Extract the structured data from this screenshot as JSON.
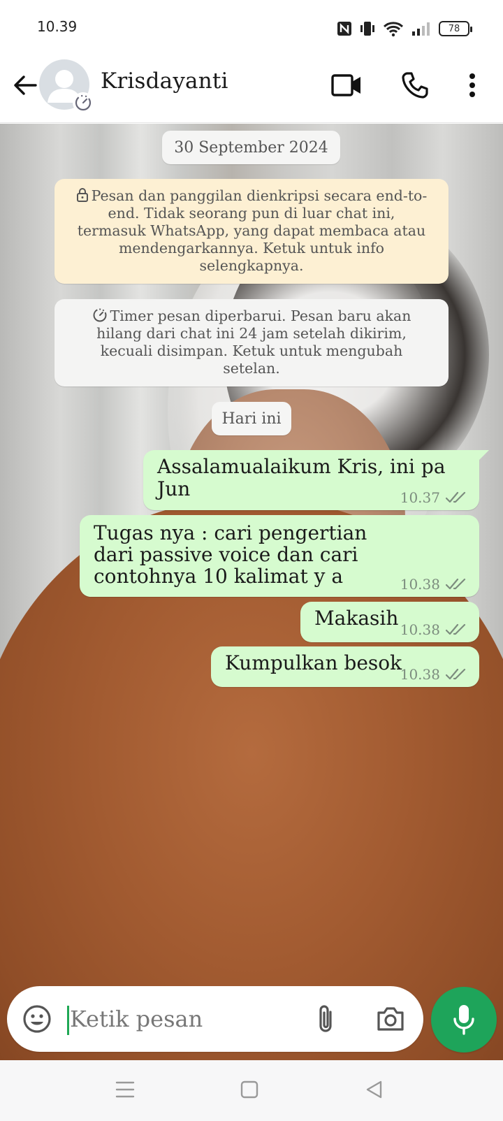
{
  "status_bar": {
    "time": "10.39",
    "battery_level": "78",
    "icons": [
      "nfc-icon",
      "vibrate-icon",
      "wifi-icon",
      "signal-icon",
      "battery-icon"
    ]
  },
  "header": {
    "contact_name": "Krisdayanti",
    "icons": {
      "back": "arrow-left-icon",
      "avatar": "default-avatar",
      "timer": "disappearing-timer-icon",
      "video": "video-camera-icon",
      "call": "phone-icon",
      "menu": "more-vert-icon"
    }
  },
  "chat": {
    "date_label": "30 September 2024",
    "encryption_notice": "Pesan dan panggilan dienkripsi secara end-to-end. Tidak seorang pun di luar chat ini, termasuk WhatsApp, yang dapat membaca atau mendengarkannya. Ketuk untuk info selengkapnya.",
    "timer_notice": "Timer pesan diperbarui. Pesan baru akan hilang dari chat ini 24 jam setelah dikirim, kecuali disimpan. Ketuk untuk mengubah setelan.",
    "today_label": "Hari ini",
    "messages": [
      {
        "text": "Assalamualaikum Kris, ini pa Jun",
        "time": "10.37",
        "status": "read"
      },
      {
        "text": "Tugas nya : cari pengertian dari passive voice dan cari contohnya 10 kalimat y a",
        "time": "10.38",
        "status": "read"
      },
      {
        "text": "Makasih",
        "time": "10.38",
        "status": "read"
      },
      {
        "text": "Kumpulkan besok",
        "time": "10.38",
        "status": "read"
      }
    ]
  },
  "input": {
    "placeholder": "Ketik pesan",
    "icons": {
      "emoji": "emoji-icon",
      "attach": "paperclip-icon",
      "camera": "camera-icon",
      "mic": "mic-icon"
    }
  },
  "colors": {
    "outgoing_bubble": "#d6fbcf",
    "encryption_bg": "#fdf0d3",
    "accent_green": "#1ea45a",
    "tick_gray": "#7c8c7e"
  },
  "nav_bar": {
    "icons": [
      "menu-icon",
      "home-square-icon",
      "back-triangle-icon"
    ]
  }
}
